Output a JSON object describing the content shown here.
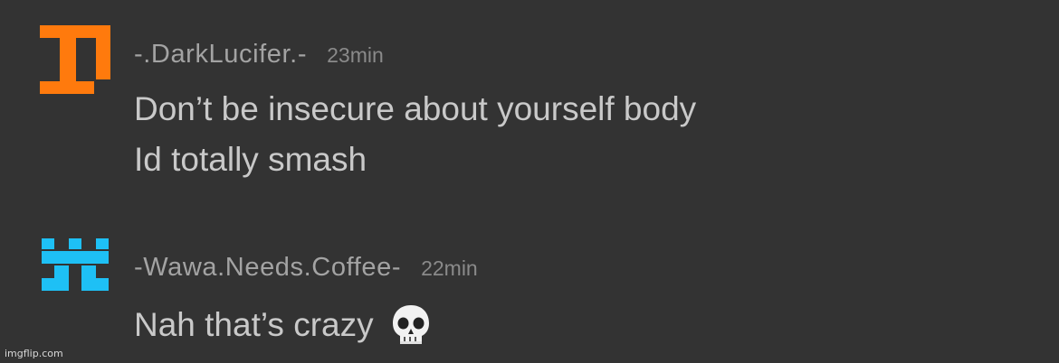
{
  "comments": [
    {
      "username": "-.DarkLucifer.-",
      "time": "23min",
      "lines": [
        "Don’t be insecure about yourself body",
        "Id totally smash"
      ],
      "avatar_icon": "orange-block-avatar-icon",
      "avatar_color": "#ff7a0d"
    },
    {
      "username": "-Wawa.Needs.Coffee-",
      "time": "22min",
      "text": "Nah that’s crazy",
      "emoji": "skull-emoji-icon",
      "avatar_icon": "blue-block-avatar-icon",
      "avatar_color": "#1ec0f5"
    }
  ],
  "background_color": "#333333",
  "watermark": "imgflip.com"
}
